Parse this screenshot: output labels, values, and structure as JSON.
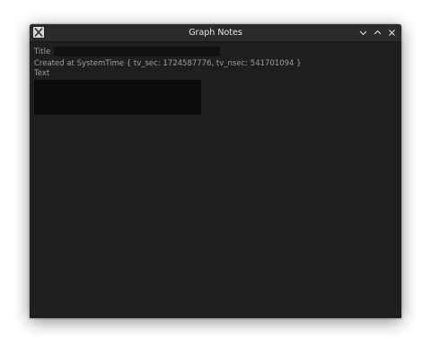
{
  "window": {
    "title": "Graph Notes"
  },
  "form": {
    "title_label": "Title",
    "title_value": "",
    "created_text": "Created at SystemTime { tv_sec: 1724587776, tv_nsec: 541701094 }",
    "text_label": "Text",
    "text_value": ""
  },
  "colors": {
    "window_bg": "#1f1f1f",
    "titlebar_bg": "#2b2b2b",
    "input_bg": "#121212",
    "textarea_bg": "#0c0c0c",
    "label_text": "#9a9a9a",
    "title_text": "#e6e6e6"
  },
  "icons": {
    "app": "x-logo-icon",
    "minimize": "chevron-down-icon",
    "maximize": "chevron-up-icon",
    "close": "close-icon"
  }
}
